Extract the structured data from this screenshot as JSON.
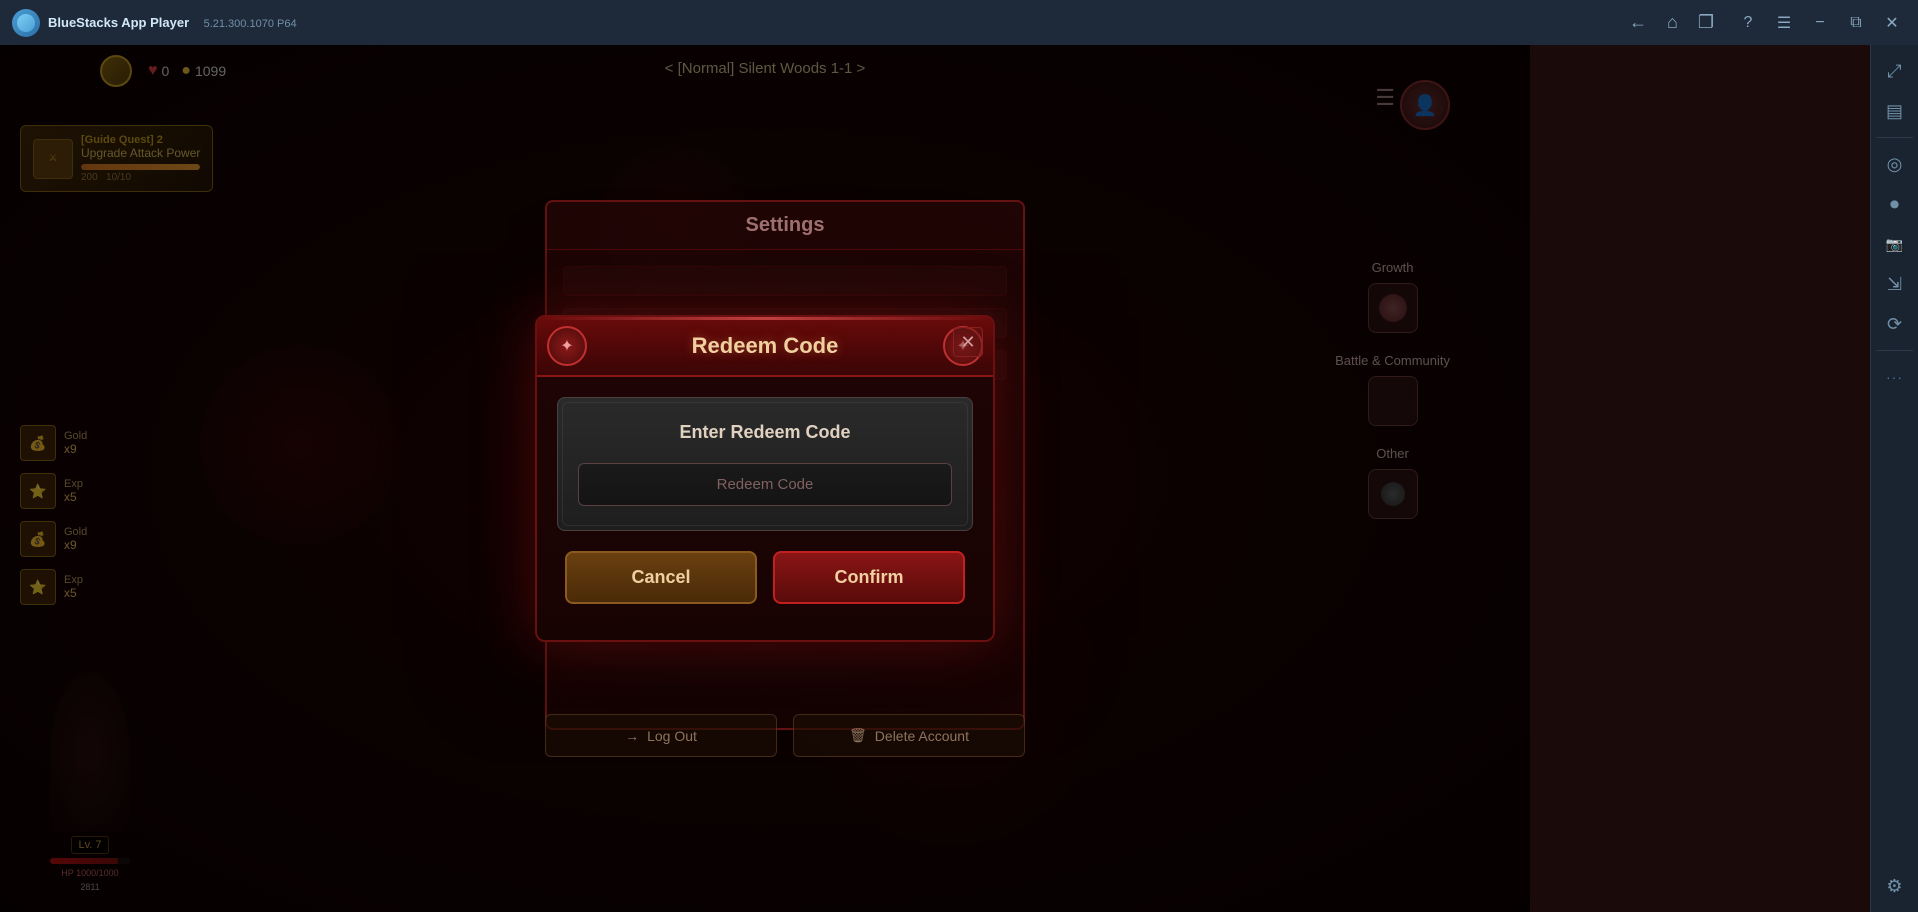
{
  "titlebar": {
    "logo_alt": "BlueStacks logo",
    "app_name": "BlueStacks App Player",
    "version": "5.21.300.1070  P64",
    "nav": {
      "back_label": "←",
      "home_label": "⌂",
      "copy_label": "❐"
    },
    "controls": {
      "help": "?",
      "menu": "☰",
      "minimize": "−",
      "restore": "❐",
      "close": "✕"
    }
  },
  "game": {
    "top_title": "< [Normal] Silent Woods 1-1 >",
    "hearts": "0",
    "coins": "1099",
    "quest": {
      "tag": "[Guide Quest] 2",
      "name": "Upgrade Attack Power",
      "level": "200",
      "progress": "10/10",
      "fill_pct": 100
    }
  },
  "settings_dialog": {
    "title": "Settings",
    "log_out_label": "Log Out",
    "delete_account_label": "Delete Account",
    "log_out_icon": "→",
    "delete_icon": "🗑"
  },
  "redeem_dialog": {
    "title": "Redeem Code",
    "close_icon": "✕",
    "ornament_left": "✦",
    "ornament_right": "✦",
    "code_label": "Enter Redeem Code",
    "input_placeholder": "Redeem Code",
    "cancel_label": "Cancel",
    "confirm_label": "Confirm"
  },
  "sidebar": {
    "icons": [
      {
        "name": "expand-icon",
        "glyph": "⤢",
        "badge": false
      },
      {
        "name": "layout-icon",
        "glyph": "▦",
        "badge": false
      },
      {
        "name": "camera-icon",
        "glyph": "◎",
        "badge": false
      },
      {
        "name": "record-icon",
        "glyph": "⏺",
        "badge": false
      },
      {
        "name": "screenshot-icon",
        "glyph": "📷",
        "badge": false
      },
      {
        "name": "resize-icon",
        "glyph": "⇲",
        "badge": false
      },
      {
        "name": "sync-icon",
        "glyph": "⟳",
        "badge": false
      },
      {
        "name": "settings-icon",
        "glyph": "⚙",
        "badge": false
      }
    ],
    "top_icons": [
      {
        "name": "expand-arrows-icon",
        "glyph": "⤢"
      },
      {
        "name": "sidebar-layout-icon",
        "glyph": "▤"
      }
    ],
    "more_label": "···"
  },
  "loot": [
    {
      "icon": "💰",
      "name": "Gold",
      "count": "x9"
    },
    {
      "icon": "⬆",
      "name": "Exp",
      "count": "x5"
    },
    {
      "icon": "💰",
      "name": "Gold",
      "count": "x9"
    },
    {
      "icon": "⬆",
      "name": "Exp",
      "count": "x5"
    }
  ],
  "game_right": {
    "growth_label": "Growth",
    "battle_label": "Battle & Community",
    "other_label": "Other"
  },
  "colors": {
    "accent_red": "#c02020",
    "gold": "#c8a020",
    "dark_bg": "#1a0404",
    "dialog_bg": "#2a0505"
  }
}
